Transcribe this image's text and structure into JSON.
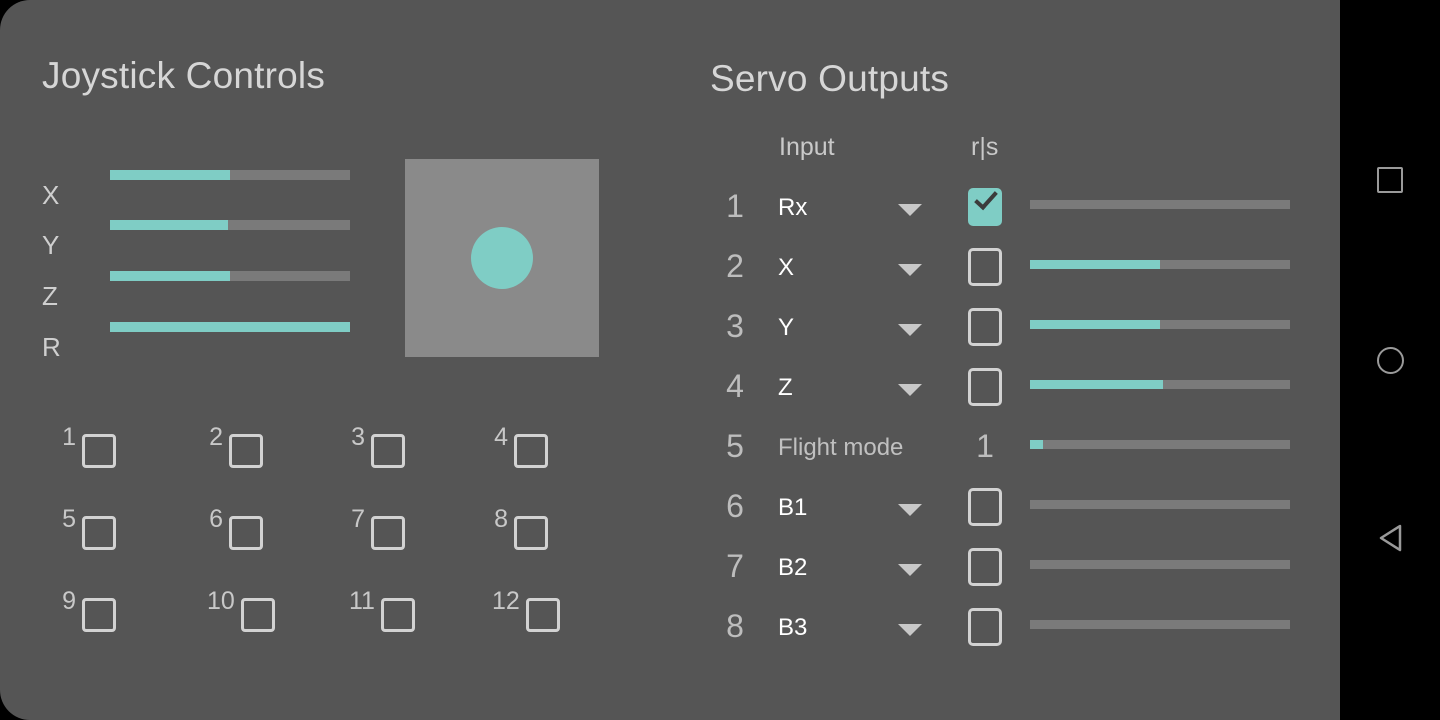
{
  "colors": {
    "accent": "#7fcdc5",
    "card_background": "#555555",
    "track": "#7a7a7a",
    "pad_background": "#8a8a8a",
    "navbar_background": "#000000",
    "text_primary": "#ffffff",
    "text_secondary": "#c9c9c9"
  },
  "joystick_panel": {
    "title": "Joystick Controls",
    "axes": [
      {
        "label": "X",
        "value_pct": 50
      },
      {
        "label": "Y",
        "value_pct": 49
      },
      {
        "label": "Z",
        "value_pct": 50
      },
      {
        "label": "R",
        "value_pct": 100
      }
    ],
    "pad": {
      "knob_x_pct": 50,
      "knob_y_pct": 50
    },
    "buttons": [
      {
        "label": "1",
        "checked": false
      },
      {
        "label": "2",
        "checked": false
      },
      {
        "label": "3",
        "checked": false
      },
      {
        "label": "4",
        "checked": false
      },
      {
        "label": "5",
        "checked": false
      },
      {
        "label": "6",
        "checked": false
      },
      {
        "label": "7",
        "checked": false
      },
      {
        "label": "8",
        "checked": false
      },
      {
        "label": "9",
        "checked": false
      },
      {
        "label": "10",
        "checked": false
      },
      {
        "label": "11",
        "checked": false
      },
      {
        "label": "12",
        "checked": false
      }
    ]
  },
  "servo_panel": {
    "title": "Servo Outputs",
    "columns": {
      "input": "Input",
      "rs": "r|s"
    },
    "rows": [
      {
        "number": "1",
        "input": "Rx",
        "has_dropdown": true,
        "rs_type": "checkbox",
        "rs_checked": true,
        "rs_value": "",
        "slider_pct": 0
      },
      {
        "number": "2",
        "input": "X",
        "has_dropdown": true,
        "rs_type": "checkbox",
        "rs_checked": false,
        "rs_value": "",
        "slider_pct": 50
      },
      {
        "number": "3",
        "input": "Y",
        "has_dropdown": true,
        "rs_type": "checkbox",
        "rs_checked": false,
        "rs_value": "",
        "slider_pct": 50
      },
      {
        "number": "4",
        "input": "Z",
        "has_dropdown": true,
        "rs_type": "checkbox",
        "rs_checked": false,
        "rs_value": "",
        "slider_pct": 51
      },
      {
        "number": "5",
        "input": "Flight mode",
        "has_dropdown": false,
        "rs_type": "value",
        "rs_checked": false,
        "rs_value": "1",
        "slider_pct": 5
      },
      {
        "number": "6",
        "input": "B1",
        "has_dropdown": true,
        "rs_type": "checkbox",
        "rs_checked": false,
        "rs_value": "",
        "slider_pct": 0
      },
      {
        "number": "7",
        "input": "B2",
        "has_dropdown": true,
        "rs_type": "checkbox",
        "rs_checked": false,
        "rs_value": "",
        "slider_pct": 0
      },
      {
        "number": "8",
        "input": "B3",
        "has_dropdown": true,
        "rs_type": "checkbox",
        "rs_checked": false,
        "rs_value": "",
        "slider_pct": 0
      }
    ]
  },
  "navbar": {
    "items": [
      {
        "icon": "square-recents-icon"
      },
      {
        "icon": "circle-home-icon"
      },
      {
        "icon": "triangle-back-icon"
      }
    ]
  }
}
